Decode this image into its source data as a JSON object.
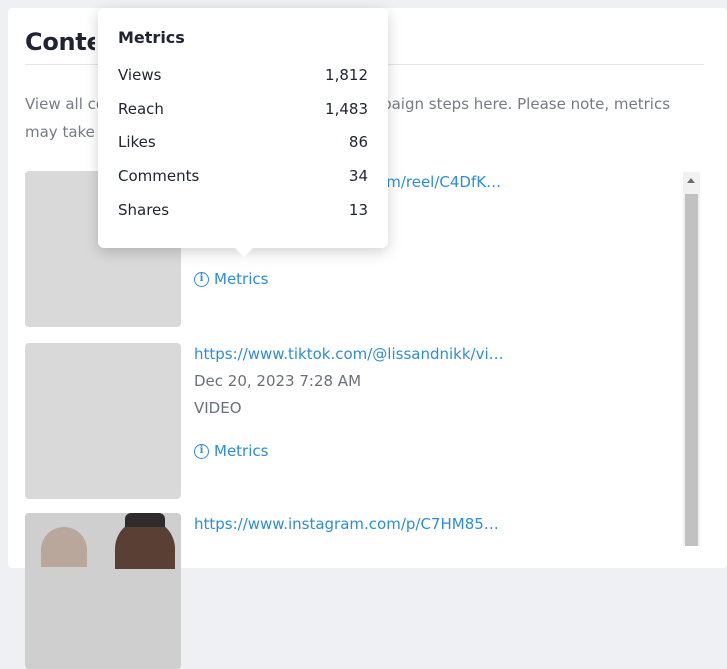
{
  "page": {
    "title": "Content"
  },
  "description": "View all content and metrics submitted for campaign steps here. Please note, metrics may take some time to update.",
  "items": [
    {
      "link": "https://www.instagram.com/reel/C4DfKVILP5-/",
      "date": "",
      "type": "",
      "metrics_label": "Metrics"
    },
    {
      "link": "https://www.tiktok.com/@lissandnikk/video/73146...",
      "date": "Dec 20, 2023 7:28 AM",
      "type": "VIDEO",
      "metrics_label": "Metrics"
    },
    {
      "link": "https://www.instagram.com/p/C7HM85Qg1jI/?",
      "date": "",
      "type": "",
      "metrics_label": "Metrics"
    }
  ],
  "tooltip": {
    "title": "Metrics",
    "rows": [
      {
        "label": "Views",
        "value": "1,812"
      },
      {
        "label": "Reach",
        "value": "1,483"
      },
      {
        "label": "Likes",
        "value": "86"
      },
      {
        "label": "Comments",
        "value": "34"
      },
      {
        "label": "Shares",
        "value": "13"
      }
    ]
  },
  "colors": {
    "link": "#2b8de0",
    "text": "#1f2430",
    "muted": "#6a707a"
  },
  "icons": {
    "metrics": "info-icon",
    "scroll": "chevron-up-icon"
  }
}
